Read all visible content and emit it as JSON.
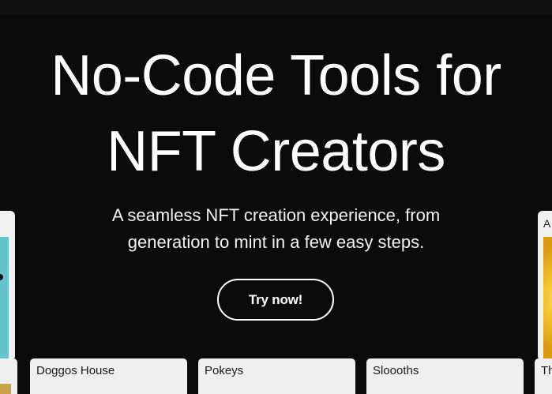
{
  "hero": {
    "title_line1": "No-Code Tools for",
    "title_line2": "NFT Creators",
    "subtitle_line1": "A seamless NFT creation experience, from",
    "subtitle_line2": "generation to mint in a few easy steps.",
    "cta_label": "Try now!"
  },
  "side_cards": {
    "right_label": "A"
  },
  "collections": [
    {
      "title": ""
    },
    {
      "title": "Doggos House"
    },
    {
      "title": "Pokeys"
    },
    {
      "title": "Sloooths"
    },
    {
      "title": "Th"
    }
  ],
  "colors": {
    "background": "#0b0b0b",
    "text": "#ffffff",
    "card": "#efefef"
  }
}
